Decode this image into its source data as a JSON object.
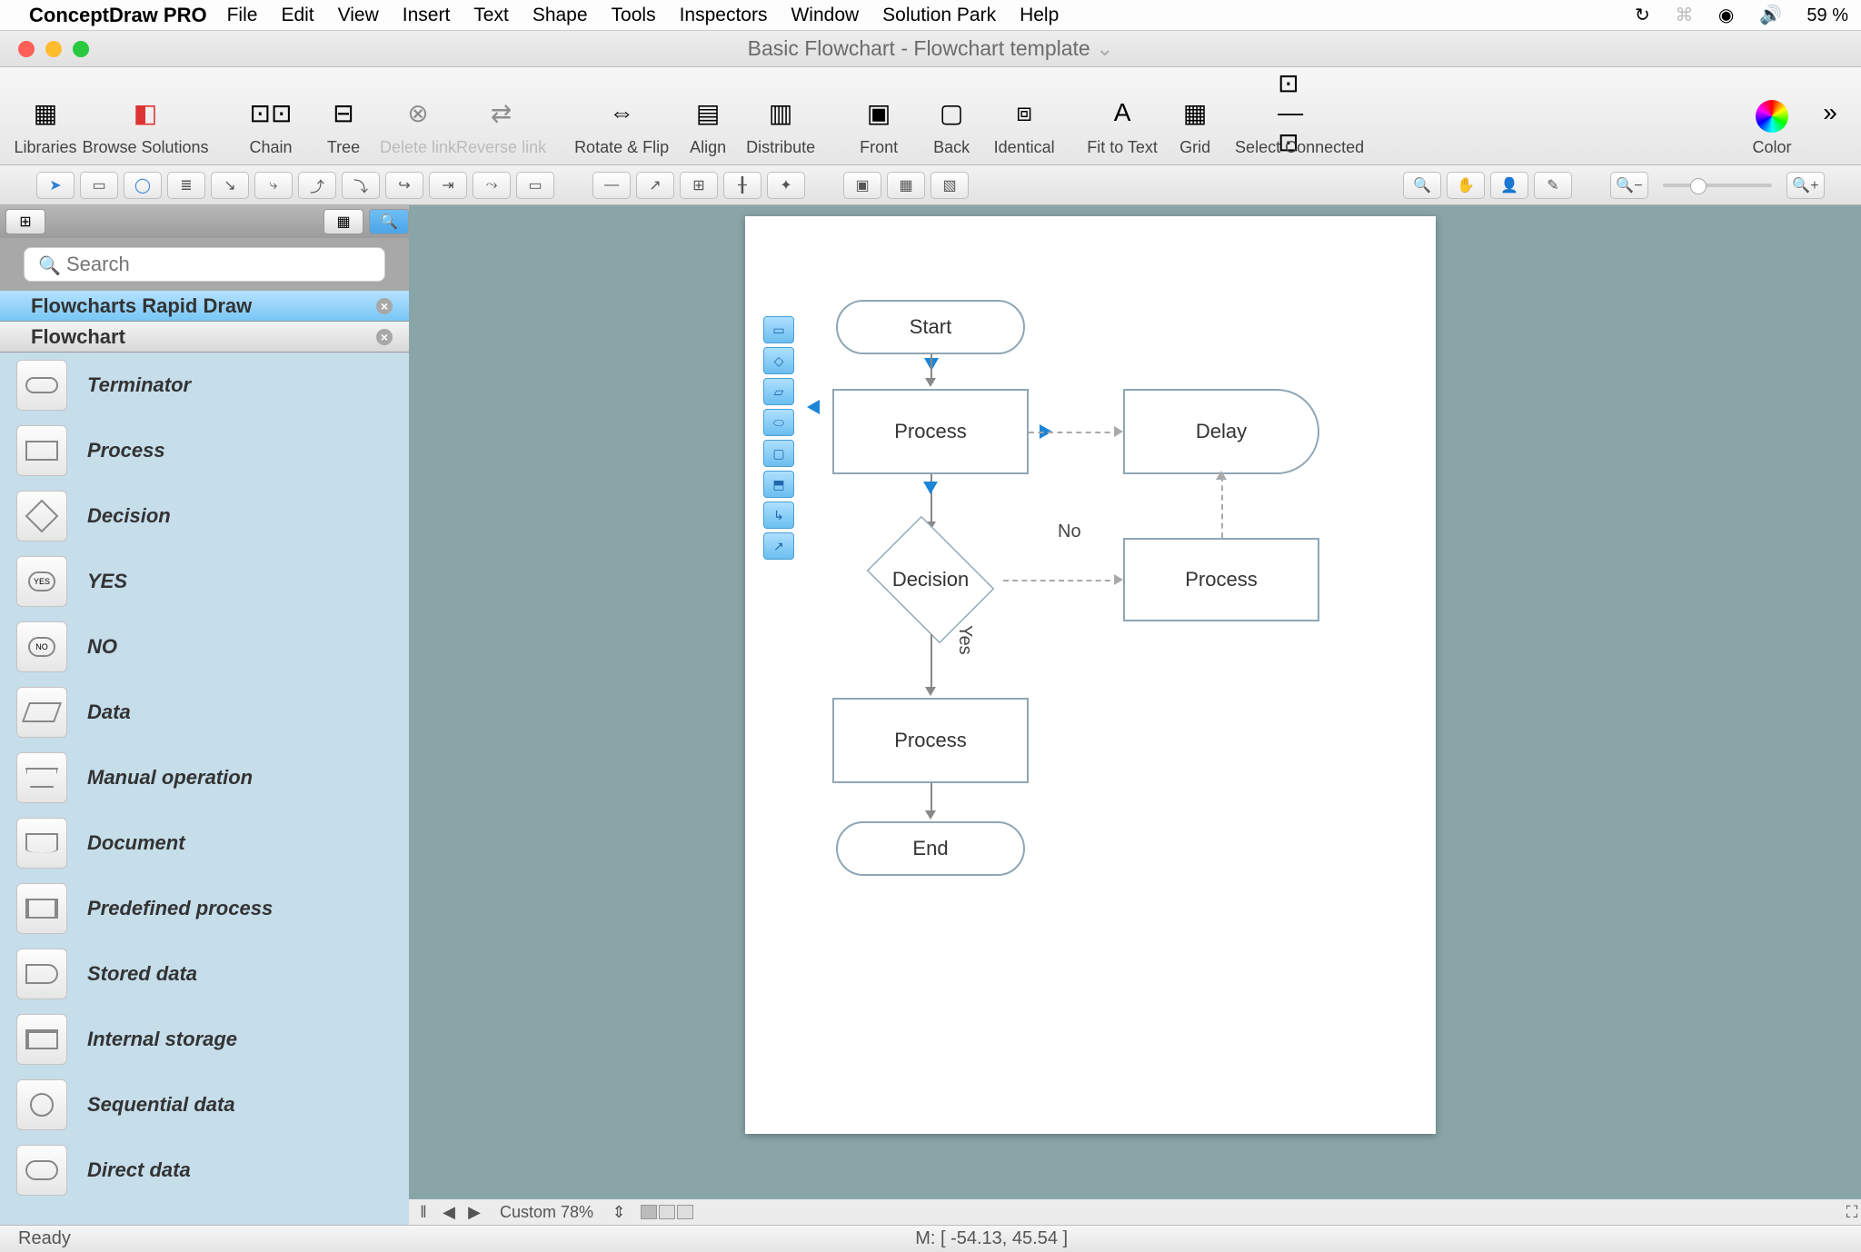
{
  "menubar": {
    "app": "ConceptDraw PRO",
    "items": [
      "File",
      "Edit",
      "View",
      "Insert",
      "Text",
      "Shape",
      "Tools",
      "Inspectors",
      "Window",
      "Solution Park",
      "Help"
    ],
    "battery": "59 %"
  },
  "titlebar": {
    "title": "Basic Flowchart - Flowchart template"
  },
  "toolbar": {
    "items": [
      {
        "label": "Libraries",
        "dim": false
      },
      {
        "label": "Browse Solutions",
        "dim": false
      },
      {
        "label": "Chain",
        "dim": false
      },
      {
        "label": "Tree",
        "dim": false
      },
      {
        "label": "Delete link",
        "dim": true
      },
      {
        "label": "Reverse link",
        "dim": true
      },
      {
        "label": "Rotate & Flip",
        "dim": false
      },
      {
        "label": "Align",
        "dim": false
      },
      {
        "label": "Distribute",
        "dim": false
      },
      {
        "label": "Front",
        "dim": false
      },
      {
        "label": "Back",
        "dim": false
      },
      {
        "label": "Identical",
        "dim": false
      },
      {
        "label": "Fit to Text",
        "dim": false
      },
      {
        "label": "Grid",
        "dim": false
      },
      {
        "label": "Select Connected",
        "dim": false
      },
      {
        "label": "Color",
        "dim": false
      }
    ]
  },
  "sidebar": {
    "search_placeholder": "Search",
    "libs": [
      {
        "name": "Flowcharts Rapid Draw",
        "selected": true
      },
      {
        "name": "Flowchart",
        "selected": false
      }
    ],
    "shapes": [
      {
        "name": "Terminator"
      },
      {
        "name": "Process"
      },
      {
        "name": "Decision"
      },
      {
        "name": "YES"
      },
      {
        "name": "NO"
      },
      {
        "name": "Data"
      },
      {
        "name": "Manual operation"
      },
      {
        "name": "Document"
      },
      {
        "name": "Predefined process"
      },
      {
        "name": "Stored data"
      },
      {
        "name": "Internal storage"
      },
      {
        "name": "Sequential data"
      },
      {
        "name": "Direct data"
      }
    ]
  },
  "canvas": {
    "nodes": {
      "start": "Start",
      "process1": "Process",
      "delay": "Delay",
      "decision": "Decision",
      "process_right": "Process",
      "process2": "Process",
      "end": "End"
    },
    "edge_labels": {
      "no": "No",
      "yes": "Yes"
    },
    "zoom_label": "Custom 78%"
  },
  "status": {
    "ready": "Ready",
    "mouse": "M: [ -54.13, 45.54 ]"
  }
}
